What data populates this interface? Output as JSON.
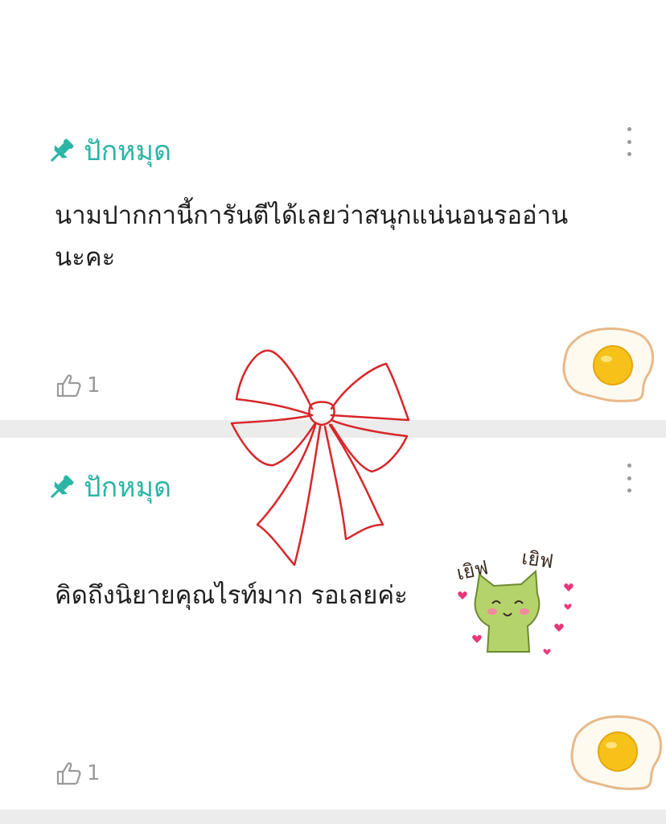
{
  "comments": [
    {
      "pin_label": "ปักหมุด",
      "text_line1": "นามปากกานี้การันตีได้เลยว่าสนุกแน่นอนรออ่าน",
      "text_line2": "นะคะ",
      "likes": "1"
    },
    {
      "pin_label": "ปักหมุด",
      "text": "คิดถึงนิยายคุณไรท์มาก รอเลยค่ะ",
      "likes": "1",
      "sticker_text_left": "เยิฟ",
      "sticker_text_right": "เยิฟ"
    }
  ],
  "colors": {
    "accent": "#2bb5a5",
    "muted": "#9a9a9a",
    "bow": "#d8262a",
    "sticker_cat": "#b5d36b",
    "heart": "#e8387a"
  },
  "icons": [
    "pin-icon",
    "more-vertical-icon",
    "thumbs-up-icon",
    "fried-egg-sticker",
    "bow-doodle",
    "cat-sticker"
  ]
}
